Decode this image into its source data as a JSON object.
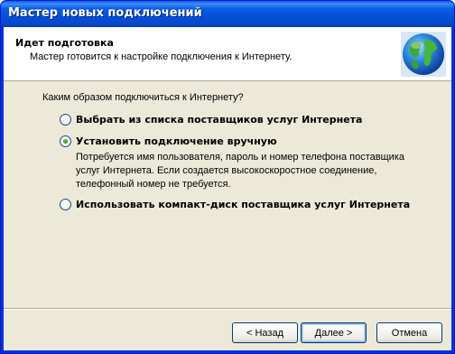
{
  "window": {
    "title": "Мастер новых подключений"
  },
  "header": {
    "title": "Идет подготовка",
    "subtitle": "Мастер готовится к настройке подключения к Интернету."
  },
  "question": "Каким образом подключиться к Интернету?",
  "options": [
    {
      "label": "Выбрать из списка поставщиков услуг Интернета",
      "checked": false
    },
    {
      "label": "Установить подключение вручную",
      "checked": true
    },
    {
      "label": "Использовать компакт-диск поставщика услуг Интернета",
      "checked": false
    }
  ],
  "manual_description": [
    "Потребуется имя пользователя, пароль и  номер телефона поставщика",
    "услуг Интернета. Если создается высокоскоростное соединение,",
    "телефонный номер не требуется."
  ],
  "buttons": {
    "back": "< Назад",
    "next": "Далее >",
    "cancel": "Отмена"
  },
  "icons": {
    "header": "globe-icon"
  },
  "colors": {
    "titlebar": "#0151da",
    "dialog_bg": "#ece9d8",
    "header_bg": "#ffffff",
    "radio_dot": "#21a121"
  }
}
